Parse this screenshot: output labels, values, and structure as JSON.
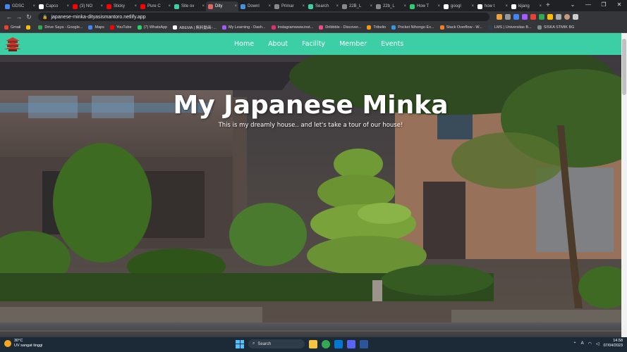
{
  "browser": {
    "tabs": [
      {
        "label": "GDSC",
        "color": "#4285f4"
      },
      {
        "label": "Capco",
        "color": "#ffffff"
      },
      {
        "label": "(3) NO",
        "color": "#ff0000"
      },
      {
        "label": "Sticky",
        "color": "#ff0000"
      },
      {
        "label": "Pure C",
        "color": "#ff0000"
      },
      {
        "label": "Site ov",
        "color": "#3ccfa5"
      },
      {
        "label": "Dity",
        "color": "#e06666",
        "active": true
      },
      {
        "label": "Downl",
        "color": "#4a90d9"
      },
      {
        "label": "Primar",
        "color": "#888888"
      },
      {
        "label": "Search",
        "color": "#3ccfa5"
      },
      {
        "label": "22B_L",
        "color": "#888888"
      },
      {
        "label": "22b_L",
        "color": "#888888"
      },
      {
        "label": "How T",
        "color": "#2ecc71"
      },
      {
        "label": "googl",
        "color": "#ffffff"
      },
      {
        "label": "how t",
        "color": "#ffffff"
      },
      {
        "label": "kijang",
        "color": "#ffffff"
      }
    ],
    "new_tab_label": "+",
    "url": "japanese-minka-dityasismantoro.netlify.app",
    "bookmarks": [
      {
        "label": "Gmail",
        "color": "#ea4335"
      },
      {
        "label": "",
        "color": "#fbbc05"
      },
      {
        "label": "Drive Saya - Google...",
        "color": "#34a853"
      },
      {
        "label": "Maps",
        "color": "#4285f4"
      },
      {
        "label": "YouTube",
        "color": "#ff0000"
      },
      {
        "label": "(7) WhatsApp",
        "color": "#25d366"
      },
      {
        "label": "ABEMA | 無料動画･...",
        "color": "#ffffff"
      },
      {
        "label": "My Learning - Dash...",
        "color": "#a259ff"
      },
      {
        "label": "Instagramwww.inst...",
        "color": "#e1306c"
      },
      {
        "label": "Dribbble - Discover...",
        "color": "#ea4c89"
      },
      {
        "label": "Tribelio",
        "color": "#f39c12"
      },
      {
        "label": "Pocket Nihongo Ex...",
        "color": "#3498db"
      },
      {
        "label": "Stack Overflow - W...",
        "color": "#f48024"
      },
      {
        "label": "LMS | Universitas B...",
        "color": "#2c3e50"
      },
      {
        "label": "SISKA STMIK BG",
        "color": "#7f8c8d"
      }
    ]
  },
  "site": {
    "brand_color": "#3ccfa5",
    "nav": [
      "Home",
      "About",
      "Facility",
      "Member",
      "Events"
    ],
    "hero_title": "My Japanese Minka",
    "hero_subtitle": "This is my dreamly house.. and let's take a tour of our house!"
  },
  "taskbar": {
    "temperature": "30°C",
    "weather": "UV sangat tinggi",
    "search_label": "Search",
    "time": "14.58",
    "date": "07/04/2023"
  }
}
